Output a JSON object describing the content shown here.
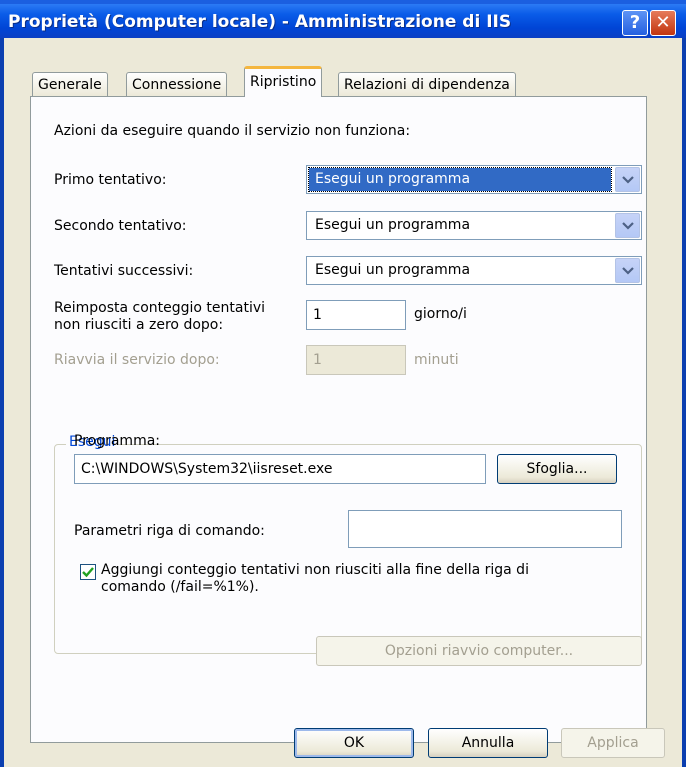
{
  "window": {
    "title": "Proprietà (Computer locale) - Amministrazione di IIS"
  },
  "titlebar_buttons": {
    "help": "?",
    "close": "✕"
  },
  "tabs": [
    {
      "label": "Generale",
      "active": false
    },
    {
      "label": "Connessione",
      "active": false
    },
    {
      "label": "Ripristino",
      "active": true
    },
    {
      "label": "Relazioni di dipendenza",
      "active": false
    }
  ],
  "panel": {
    "heading": "Azioni da eseguire quando il servizio non funziona:",
    "first_failure": {
      "label": "Primo tentativo:",
      "value": "Esegui un programma"
    },
    "second_failure": {
      "label": "Secondo tentativo:",
      "value": "Esegui un programma"
    },
    "subsequent_failures": {
      "label": "Tentativi successivi:",
      "value": "Esegui un programma"
    },
    "reset_count": {
      "label_line1": "Reimposta conteggio tentativi",
      "label_line2": "non riusciti a zero dopo:",
      "value": "1",
      "unit": "giorno/i"
    },
    "restart_service": {
      "label": "Riavvia il servizio dopo:",
      "value": "1",
      "unit": "minuti"
    },
    "run_program": {
      "group_title": "Esegui",
      "program_label": "Programma:",
      "program_value": "C:\\WINDOWS\\System32\\iisreset.exe",
      "browse_label": "Sfoglia...",
      "params_label": "Parametri riga di comando:",
      "params_value": "",
      "append_fail_count": {
        "checked": true,
        "label_line1": "Aggiungi conteggio tentativi non riusciti alla fine della riga di",
        "label_line2": "comando (/fail=%1%)."
      }
    },
    "restart_options_label": "Opzioni riavvio computer..."
  },
  "footer": {
    "ok": "OK",
    "cancel": "Annulla",
    "apply": "Applica"
  },
  "colors": {
    "title_bar": "#0a5ce8",
    "dialog_bg": "#ece9d8",
    "accent_tab": "#f4b63f",
    "selection": "#316ac5"
  }
}
